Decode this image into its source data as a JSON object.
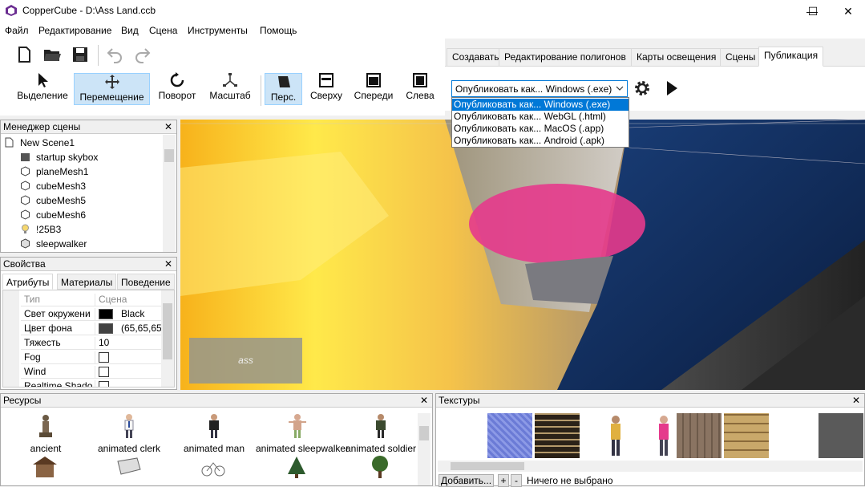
{
  "window": {
    "title": "CopperCube - D:\\Ass Land.ccb",
    "min": "—",
    "max": "☐",
    "close": "✕"
  },
  "menu": [
    "Файл",
    "Редактирование",
    "Вид",
    "Сцена",
    "Инструменты",
    "Помощь"
  ],
  "toolbar": {
    "tools": [
      {
        "label": "Выделение",
        "icon": "cursor-icon",
        "active": false
      },
      {
        "label": "Перемещение",
        "icon": "move-icon",
        "active": true
      },
      {
        "label": "Поворот",
        "icon": "rotate-icon",
        "active": false
      },
      {
        "label": "Масштаб",
        "icon": "scale-icon",
        "active": false
      }
    ],
    "views": [
      {
        "label": "Перс.",
        "icon": "perspective-icon",
        "active": true
      },
      {
        "label": "Сверху",
        "icon": "top-view-icon",
        "active": false
      },
      {
        "label": "Спереди",
        "icon": "front-view-icon",
        "active": false
      },
      {
        "label": "Слева",
        "icon": "left-view-icon",
        "active": false
      }
    ]
  },
  "tabs": [
    "Создавать",
    "Редактирование полигонов",
    "Карты освещения",
    "Сцены",
    "Публикация"
  ],
  "publish": {
    "selected": "Опубликовать как... Windows (.exe)",
    "options": [
      "Опубликовать как... Windows (.exe)",
      "Опубликовать как... WebGL (.html)",
      "Опубликовать как... MacOS (.app)",
      "Опубликовать как... Android (.apk)"
    ]
  },
  "scene_manager": {
    "title": "Менеджер сцены",
    "close": "✕",
    "items": [
      "New Scene1",
      "startup skybox",
      "planeMesh1",
      "cubeMesh3",
      "cubeMesh5",
      "cubeMesh6",
      "!25B3",
      "sleepwalker"
    ]
  },
  "properties": {
    "title": "Свойства",
    "close": "✕",
    "tabs": [
      "Атрибуты",
      "Материалы",
      "Поведение"
    ],
    "rows": [
      {
        "key": "Тип",
        "value": "Сцена"
      },
      {
        "key": "Свет окружени",
        "value": "Black",
        "color": "#000000"
      },
      {
        "key": "Цвет фона",
        "value": "(65,65,65)",
        "color": "#414141"
      },
      {
        "key": "Тяжесть",
        "value": "10"
      },
      {
        "key": "Fog",
        "value": ""
      },
      {
        "key": "Wind",
        "value": ""
      },
      {
        "key": "Realtime Shado",
        "value": ""
      }
    ]
  },
  "viewport": {
    "overlay_label": "ass"
  },
  "resources": {
    "title": "Ресурсы",
    "close": "✕",
    "items": [
      "ancient",
      "animated clerk",
      "animated man",
      "animated sleepwalker",
      "animated soldier"
    ]
  },
  "textures": {
    "title": "Текстуры",
    "close": "✕",
    "add": "Добавить...",
    "plus": "+",
    "minus": "-",
    "status": "Ничего не выбрано"
  }
}
